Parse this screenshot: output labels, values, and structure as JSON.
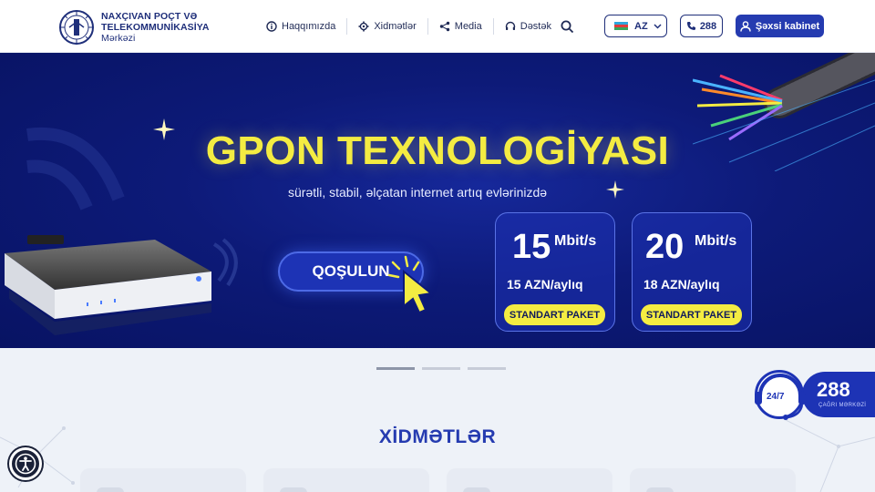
{
  "brand": {
    "line1": "NAXÇIVAN POÇT VƏ",
    "line2": "TELEKOMMUNİKASİYA",
    "line3": "Mərkəzi"
  },
  "nav": {
    "about": "Haqqımızda",
    "services": "Xidmətlər",
    "media": "Media",
    "support": "Dəstək"
  },
  "header": {
    "lang": "AZ",
    "phone": "288",
    "cabinet": "Şəxsi kabinet"
  },
  "hero": {
    "title": "GPON TEXNOLOGİYASI",
    "subtitle": "sürətli, stabil, əlçatan internet artıq evlərinizdə",
    "cta": "QOŞULUN",
    "plans": [
      {
        "speed": "15",
        "unit": "Mbit/s",
        "price": "15 AZN/aylıq",
        "package": "STANDART PAKET"
      },
      {
        "speed": "20",
        "unit": "Mbit/s",
        "price": "18 AZN/aylıq",
        "package": "STANDART PAKET"
      }
    ]
  },
  "carousel": {
    "slides": 3,
    "active": 1
  },
  "services": {
    "title": "XİDMƏTLƏR"
  },
  "support_widget": {
    "hours": "24/7",
    "number": "288",
    "label": "ÇAĞRI MƏRKƏZİ"
  },
  "colors": {
    "primary": "#253bb0",
    "accent": "#f4ec42",
    "hero_bg": "#0d1a78"
  }
}
